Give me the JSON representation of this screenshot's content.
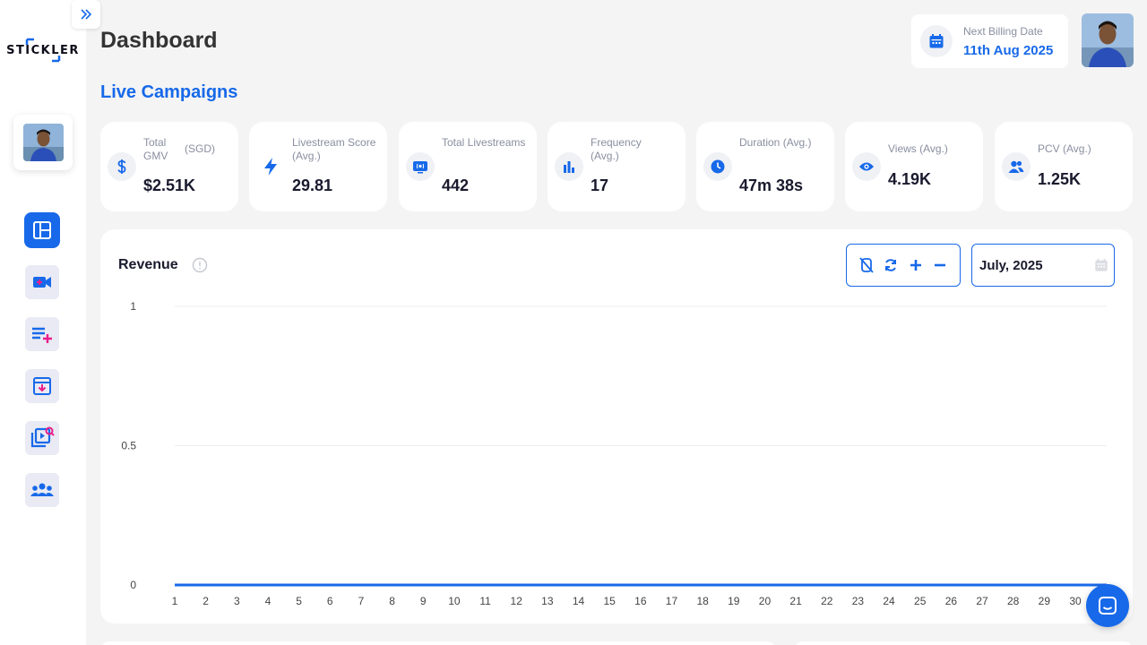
{
  "brand": {
    "logo_text": "STICKLER",
    "accent": "#1769e9",
    "secondary": "#e91e8c"
  },
  "header": {
    "title": "Dashboard",
    "billing_label": "Next Billing Date",
    "billing_value": "11th Aug 2025"
  },
  "section_title": "Live Campaigns",
  "stats": [
    {
      "label": "Total GMV",
      "suffix": "(SGD)",
      "value": "$2.51K",
      "icon": "dollar-icon"
    },
    {
      "label": "Livestream Score (Avg.)",
      "value": "29.81",
      "icon": "lightning-icon"
    },
    {
      "label": "Total Livestreams",
      "value": "442",
      "icon": "live-tv-icon"
    },
    {
      "label": "Frequency (Avg.)",
      "value": "17",
      "icon": "bar-chart-icon"
    },
    {
      "label": "Duration (Avg.)",
      "value": "47m 38s",
      "icon": "clock-icon"
    },
    {
      "label": "Views (Avg.)",
      "value": "4.19K",
      "icon": "eye-icon"
    },
    {
      "label": "PCV (Avg.)",
      "value": "1.25K",
      "icon": "users-icon"
    }
  ],
  "nav": [
    {
      "name": "dashboard",
      "icon": "dashboard-icon",
      "active": true
    },
    {
      "name": "add-video",
      "icon": "video-add-icon"
    },
    {
      "name": "playlist-add",
      "icon": "playlist-add-icon"
    },
    {
      "name": "archive",
      "icon": "archive-download-icon"
    },
    {
      "name": "library-search",
      "icon": "library-search-icon"
    },
    {
      "name": "team",
      "icon": "team-icon"
    }
  ],
  "revenue": {
    "title": "Revenue",
    "month": "July, 2025"
  },
  "chart_data": {
    "type": "line",
    "title": "Revenue",
    "x": [
      1,
      2,
      3,
      4,
      5,
      6,
      7,
      8,
      9,
      10,
      11,
      12,
      13,
      14,
      15,
      16,
      17,
      18,
      19,
      20,
      21,
      22,
      23,
      24,
      25,
      26,
      27,
      28,
      29,
      30
    ],
    "series": [
      {
        "values": [
          0,
          0,
          0,
          0,
          0,
          0,
          0,
          0,
          0,
          0,
          0,
          0,
          0,
          0,
          0,
          0,
          0,
          0,
          0,
          0,
          0,
          0,
          0,
          0,
          0,
          0,
          0,
          0,
          0,
          0
        ]
      }
    ],
    "yticks": [
      "0",
      "0.5",
      "1"
    ],
    "ylim": [
      0,
      1
    ],
    "grid": true
  }
}
